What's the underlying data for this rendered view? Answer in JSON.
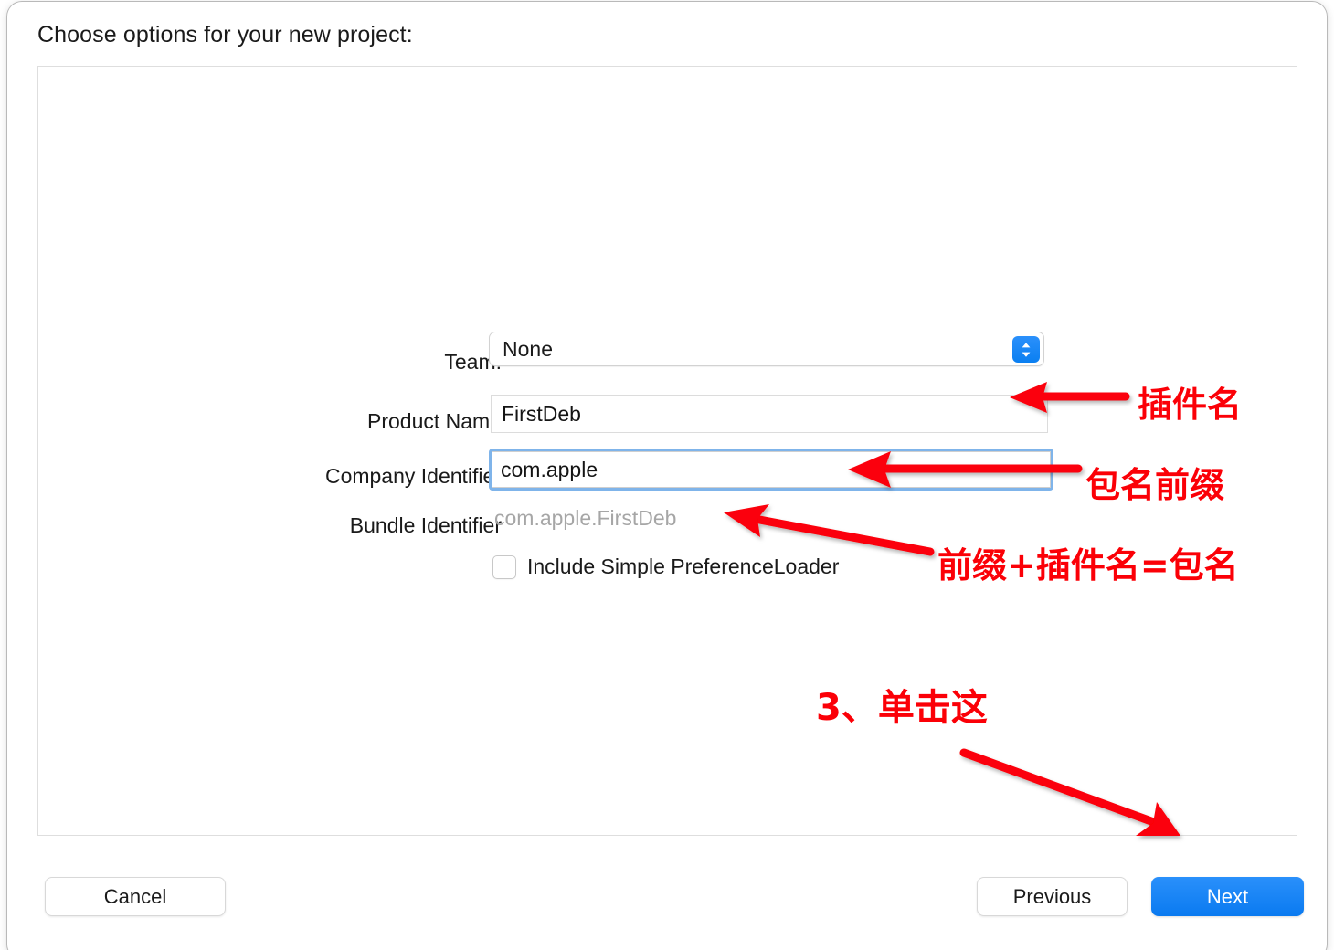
{
  "dialog": {
    "headline": "Choose options for your new project:"
  },
  "form": {
    "team": {
      "label": "Team:",
      "value": "None",
      "stepper_icon": "chevron-up-down-icon"
    },
    "product_name": {
      "label": "Product Name",
      "value": "FirstDeb"
    },
    "company_identifier": {
      "label": "Company Identifier",
      "value": "com.apple"
    },
    "bundle_identifier": {
      "label": "Bundle Identifier",
      "value": "com.apple.FirstDeb"
    },
    "include_preference_loader": {
      "label": "Include Simple PreferenceLoader",
      "checked": false
    }
  },
  "footer": {
    "cancel": "Cancel",
    "previous": "Previous",
    "next": "Next"
  },
  "annotations": {
    "plugin_name": "插件名",
    "package_prefix": "包名前缀",
    "package_formula": "前缀+插件名=包名",
    "click_this": "3、单击这",
    "color": "#fb0007"
  }
}
